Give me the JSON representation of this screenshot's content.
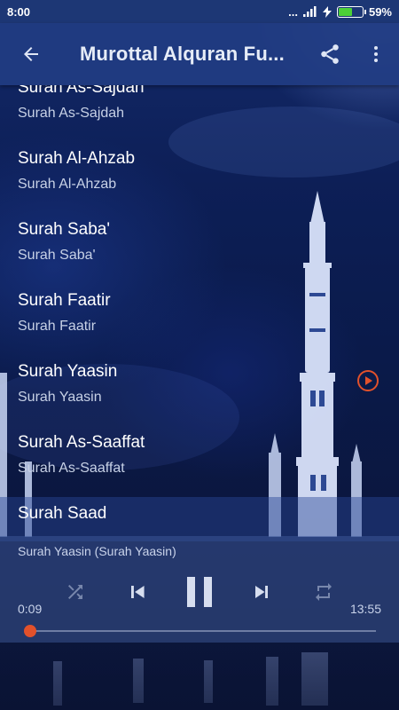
{
  "status_bar": {
    "time": "8:00",
    "signal": "...",
    "battery_percent": "59%",
    "battery_level": 0.59
  },
  "app_bar": {
    "title": "Murottal Alquran Fu...",
    "back_icon": "arrow-left-icon",
    "share_icon": "share-icon",
    "more_icon": "more-vert-icon"
  },
  "list": {
    "items": [
      {
        "name": "Surah As-Sajdah",
        "sub": "Surah As-Sajdah",
        "playing": false
      },
      {
        "name": "Surah Al-Ahzab",
        "sub": "Surah Al-Ahzab",
        "playing": false
      },
      {
        "name": "Surah Saba'",
        "sub": "Surah Saba'",
        "playing": false
      },
      {
        "name": "Surah Faatir",
        "sub": "Surah Faatir",
        "playing": false
      },
      {
        "name": "Surah Yaasin",
        "sub": "Surah Yaasin",
        "playing": true
      },
      {
        "name": "Surah As-Saaffat",
        "sub": "Surah As-Saaffat",
        "playing": false
      },
      {
        "name": "Surah Saad",
        "sub": "",
        "playing": false
      }
    ]
  },
  "player": {
    "track": "Surah Yaasin (Surah Yaasin)",
    "current_time": "0:09",
    "total_time": "13:55",
    "progress": 0.011,
    "accent": "#e2512b"
  }
}
